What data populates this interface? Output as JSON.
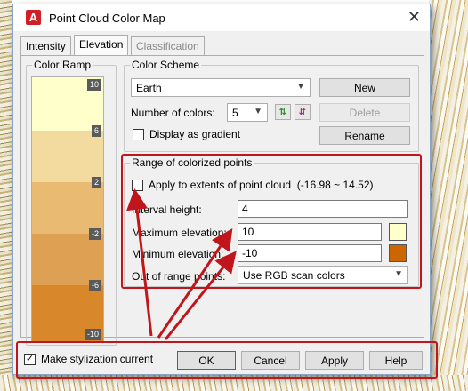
{
  "window": {
    "title": "Point Cloud Color Map",
    "app_icon_letter": "A",
    "close_glyph": "✕"
  },
  "tabs": [
    {
      "label": "Intensity",
      "active": false,
      "enabled": true
    },
    {
      "label": "Elevation",
      "active": true,
      "enabled": true
    },
    {
      "label": "Classification",
      "active": false,
      "enabled": false
    }
  ],
  "color_ramp": {
    "title": "Color Ramp",
    "ticks": [
      "10",
      "6",
      "2",
      "-2",
      "-6",
      "-10"
    ],
    "bands": [
      "#ffffcc",
      "#f3dba0",
      "#e8ba72",
      "#dea053",
      "#d8872b",
      "#cc6600"
    ]
  },
  "color_scheme": {
    "title": "Color Scheme",
    "scheme_value": "Earth",
    "new_label": "New",
    "num_colors_label": "Number of colors:",
    "num_colors_value": "5",
    "delete_label": "Delete",
    "gradient_label": "Display as gradient",
    "gradient_checked": false,
    "rename_label": "Rename"
  },
  "range": {
    "title": "Range of colorized points",
    "apply_label": "Apply to extents of point cloud",
    "extents_text": "(-16.98 ~ 14.52)",
    "apply_checked": false,
    "interval_label": "Interval height:",
    "interval_value": "4",
    "max_label": "Maximum elevation:",
    "max_value": "10",
    "max_color": "#ffffcc",
    "min_label": "Minimum elevation:",
    "min_value": "-10",
    "min_color": "#cc6600",
    "out_label": "Out of range points:",
    "out_value": "Use RGB scan colors"
  },
  "footer": {
    "stylization_label": "Make stylization current",
    "stylization_checked": true,
    "check_glyph": "✓",
    "ok_label": "OK",
    "cancel_label": "Cancel",
    "apply_label": "Apply",
    "help_label": "Help"
  },
  "colors": {
    "annotation_red": "#c0151a",
    "accent_blue": "#0078d7"
  }
}
